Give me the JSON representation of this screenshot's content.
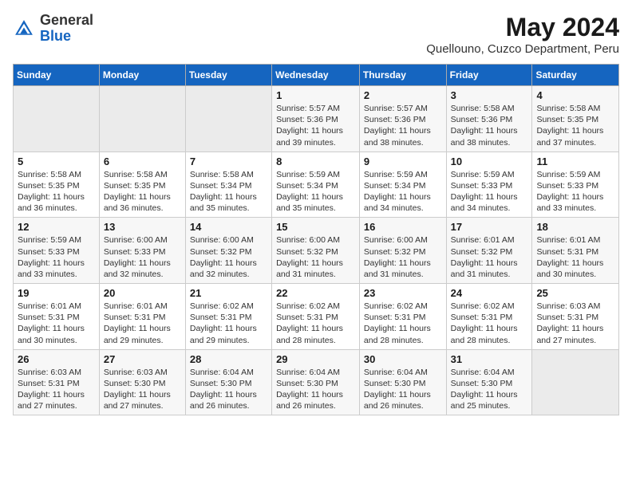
{
  "header": {
    "logo_general": "General",
    "logo_blue": "Blue",
    "title": "May 2024",
    "subtitle": "Quellouno, Cuzco Department, Peru"
  },
  "weekdays": [
    "Sunday",
    "Monday",
    "Tuesday",
    "Wednesday",
    "Thursday",
    "Friday",
    "Saturday"
  ],
  "weeks": [
    [
      {
        "day": "",
        "info": ""
      },
      {
        "day": "",
        "info": ""
      },
      {
        "day": "",
        "info": ""
      },
      {
        "day": "1",
        "info": "Sunrise: 5:57 AM\nSunset: 5:36 PM\nDaylight: 11 hours\nand 39 minutes."
      },
      {
        "day": "2",
        "info": "Sunrise: 5:57 AM\nSunset: 5:36 PM\nDaylight: 11 hours\nand 38 minutes."
      },
      {
        "day": "3",
        "info": "Sunrise: 5:58 AM\nSunset: 5:36 PM\nDaylight: 11 hours\nand 38 minutes."
      },
      {
        "day": "4",
        "info": "Sunrise: 5:58 AM\nSunset: 5:35 PM\nDaylight: 11 hours\nand 37 minutes."
      }
    ],
    [
      {
        "day": "5",
        "info": "Sunrise: 5:58 AM\nSunset: 5:35 PM\nDaylight: 11 hours\nand 36 minutes."
      },
      {
        "day": "6",
        "info": "Sunrise: 5:58 AM\nSunset: 5:35 PM\nDaylight: 11 hours\nand 36 minutes."
      },
      {
        "day": "7",
        "info": "Sunrise: 5:58 AM\nSunset: 5:34 PM\nDaylight: 11 hours\nand 35 minutes."
      },
      {
        "day": "8",
        "info": "Sunrise: 5:59 AM\nSunset: 5:34 PM\nDaylight: 11 hours\nand 35 minutes."
      },
      {
        "day": "9",
        "info": "Sunrise: 5:59 AM\nSunset: 5:34 PM\nDaylight: 11 hours\nand 34 minutes."
      },
      {
        "day": "10",
        "info": "Sunrise: 5:59 AM\nSunset: 5:33 PM\nDaylight: 11 hours\nand 34 minutes."
      },
      {
        "day": "11",
        "info": "Sunrise: 5:59 AM\nSunset: 5:33 PM\nDaylight: 11 hours\nand 33 minutes."
      }
    ],
    [
      {
        "day": "12",
        "info": "Sunrise: 5:59 AM\nSunset: 5:33 PM\nDaylight: 11 hours\nand 33 minutes."
      },
      {
        "day": "13",
        "info": "Sunrise: 6:00 AM\nSunset: 5:33 PM\nDaylight: 11 hours\nand 32 minutes."
      },
      {
        "day": "14",
        "info": "Sunrise: 6:00 AM\nSunset: 5:32 PM\nDaylight: 11 hours\nand 32 minutes."
      },
      {
        "day": "15",
        "info": "Sunrise: 6:00 AM\nSunset: 5:32 PM\nDaylight: 11 hours\nand 31 minutes."
      },
      {
        "day": "16",
        "info": "Sunrise: 6:00 AM\nSunset: 5:32 PM\nDaylight: 11 hours\nand 31 minutes."
      },
      {
        "day": "17",
        "info": "Sunrise: 6:01 AM\nSunset: 5:32 PM\nDaylight: 11 hours\nand 31 minutes."
      },
      {
        "day": "18",
        "info": "Sunrise: 6:01 AM\nSunset: 5:31 PM\nDaylight: 11 hours\nand 30 minutes."
      }
    ],
    [
      {
        "day": "19",
        "info": "Sunrise: 6:01 AM\nSunset: 5:31 PM\nDaylight: 11 hours\nand 30 minutes."
      },
      {
        "day": "20",
        "info": "Sunrise: 6:01 AM\nSunset: 5:31 PM\nDaylight: 11 hours\nand 29 minutes."
      },
      {
        "day": "21",
        "info": "Sunrise: 6:02 AM\nSunset: 5:31 PM\nDaylight: 11 hours\nand 29 minutes."
      },
      {
        "day": "22",
        "info": "Sunrise: 6:02 AM\nSunset: 5:31 PM\nDaylight: 11 hours\nand 28 minutes."
      },
      {
        "day": "23",
        "info": "Sunrise: 6:02 AM\nSunset: 5:31 PM\nDaylight: 11 hours\nand 28 minutes."
      },
      {
        "day": "24",
        "info": "Sunrise: 6:02 AM\nSunset: 5:31 PM\nDaylight: 11 hours\nand 28 minutes."
      },
      {
        "day": "25",
        "info": "Sunrise: 6:03 AM\nSunset: 5:31 PM\nDaylight: 11 hours\nand 27 minutes."
      }
    ],
    [
      {
        "day": "26",
        "info": "Sunrise: 6:03 AM\nSunset: 5:31 PM\nDaylight: 11 hours\nand 27 minutes."
      },
      {
        "day": "27",
        "info": "Sunrise: 6:03 AM\nSunset: 5:30 PM\nDaylight: 11 hours\nand 27 minutes."
      },
      {
        "day": "28",
        "info": "Sunrise: 6:04 AM\nSunset: 5:30 PM\nDaylight: 11 hours\nand 26 minutes."
      },
      {
        "day": "29",
        "info": "Sunrise: 6:04 AM\nSunset: 5:30 PM\nDaylight: 11 hours\nand 26 minutes."
      },
      {
        "day": "30",
        "info": "Sunrise: 6:04 AM\nSunset: 5:30 PM\nDaylight: 11 hours\nand 26 minutes."
      },
      {
        "day": "31",
        "info": "Sunrise: 6:04 AM\nSunset: 5:30 PM\nDaylight: 11 hours\nand 25 minutes."
      },
      {
        "day": "",
        "info": ""
      }
    ]
  ]
}
